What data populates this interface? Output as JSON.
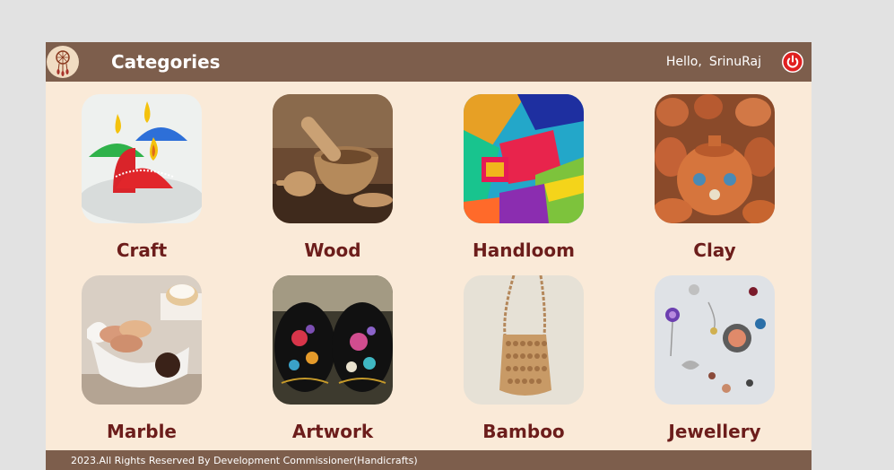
{
  "header": {
    "title": "Categories",
    "greeting": "Hello,",
    "username": "SrinuRaj",
    "logo_icon": "dreamcatcher-icon",
    "logout_icon": "power-icon"
  },
  "categories": [
    {
      "label": "Craft",
      "image": "paper-fan-lamps"
    },
    {
      "label": "Wood",
      "image": "wooden-mortar-pestle"
    },
    {
      "label": "Handloom",
      "image": "colorful-fabrics"
    },
    {
      "label": "Clay",
      "image": "painted-clay-pots"
    },
    {
      "label": "Marble",
      "image": "white-marble-dish-macarons"
    },
    {
      "label": "Artwork",
      "image": "lacquered-floral-boxes"
    },
    {
      "label": "Bamboo",
      "image": "woven-bead-bag"
    },
    {
      "label": "Jewellery",
      "image": "charm-pendants"
    }
  ],
  "footer": {
    "text": "2023.All Rights Reserved By Development Commissioner(Handicrafts)"
  },
  "colors": {
    "background": "#e2e2e2",
    "header": "#7d5e4c",
    "panel": "#faead8",
    "label": "#6c1d1b",
    "power": "#e02020"
  }
}
